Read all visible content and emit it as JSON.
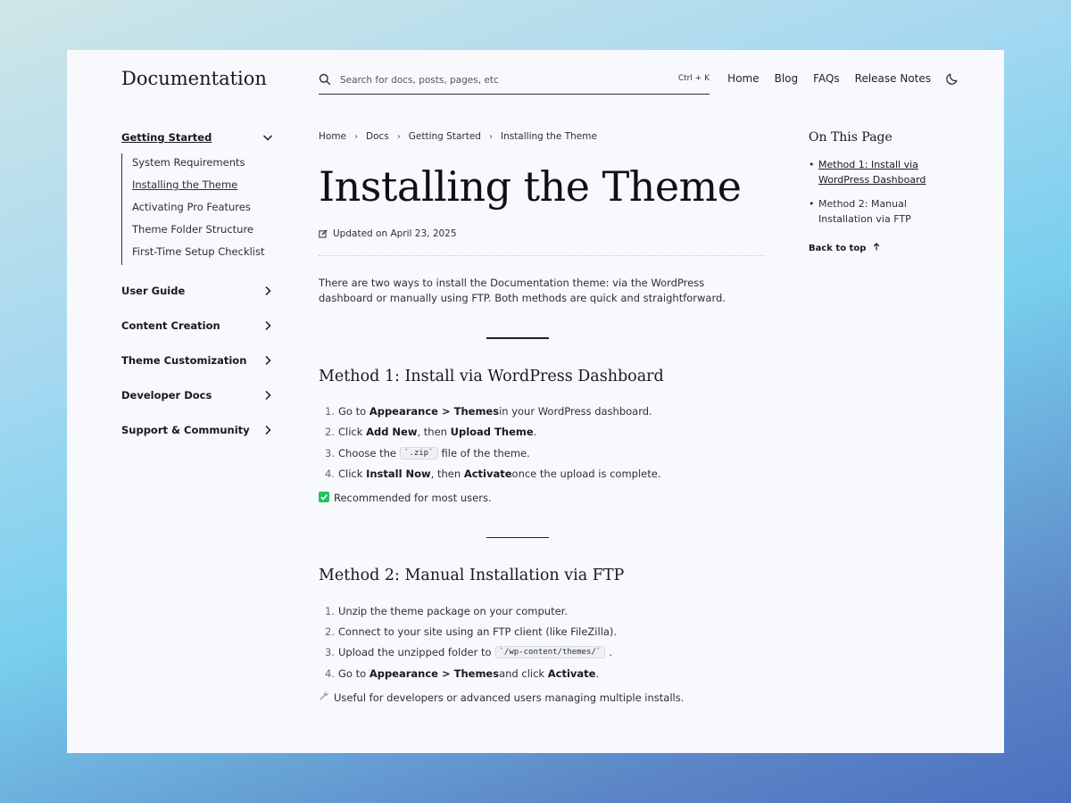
{
  "header": {
    "site_title": "Documentation",
    "search_placeholder": "Search for docs, posts, pages, etc",
    "search_shortcut": "Ctrl + K",
    "nav": [
      "Home",
      "Blog",
      "FAQs",
      "Release Notes"
    ]
  },
  "sidebar": {
    "active_section": "Getting Started",
    "active_items": [
      "System Requirements",
      "Installing the Theme",
      "Activating Pro Features",
      "Theme Folder Structure",
      "First-Time Setup Checklist"
    ],
    "sections": [
      "User Guide",
      "Content Creation",
      "Theme Customization",
      "Developer Docs",
      "Support & Community"
    ]
  },
  "breadcrumb": [
    "Home",
    "Docs",
    "Getting Started",
    "Installing the Theme"
  ],
  "page": {
    "title": "Installing the Theme",
    "updated": "Updated on April 23, 2025",
    "intro": "There are two ways to install the Documentation theme: via the WordPress dashboard or manually using FTP. Both methods are quick and straightforward.",
    "method1": {
      "heading": "Method 1: Install via WordPress Dashboard",
      "steps": [
        {
          "n": "1.",
          "a": "Go to ",
          "b": "Appearance > Themes",
          "c": " in your WordPress dashboard."
        },
        {
          "n": "2.",
          "a": "Click ",
          "b": "Add New",
          "c": ", then ",
          "d": "Upload Theme",
          "e": "."
        },
        {
          "n": "3.",
          "a": "Choose the ",
          "code": "`.zip`",
          "c": " file of the theme."
        },
        {
          "n": "4.",
          "a": "Click ",
          "b": "Install Now",
          "c": ", then ",
          "d": "Activate",
          "e": " once the upload is complete."
        }
      ],
      "note": "Recommended for most users."
    },
    "method2": {
      "heading": "Method 2: Manual Installation via FTP",
      "steps": [
        {
          "n": "1.",
          "a": "Unzip the theme package on your computer."
        },
        {
          "n": "2.",
          "a": "Connect to your site using an FTP client (like FileZilla)."
        },
        {
          "n": "3.",
          "a": "Upload the unzipped folder to ",
          "code": "`/wp-content/themes/`",
          "c": "."
        },
        {
          "n": "4.",
          "a": "Go to ",
          "b": "Appearance > Themes",
          "c": " and click ",
          "d": "Activate",
          "e": "."
        }
      ],
      "note": "Useful for developers or advanced users managing multiple installs."
    }
  },
  "toc": {
    "title": "On This Page",
    "items": [
      "Method 1: Install via WordPress Dashboard",
      "Method 2: Manual Installation via FTP"
    ],
    "back_to_top": "Back to top"
  },
  "icons": {
    "search": "search-icon",
    "theme_toggle": "moon-icon",
    "chevron_down": "chevron-down-icon",
    "chevron_right": "chevron-right-icon",
    "edit": "edit-icon",
    "check": "check-box-icon",
    "wrench": "wrench-icon",
    "arrow_up": "arrow-up-icon"
  },
  "colors": {
    "check_green": "#22c55e",
    "page_bg": "#f7f9fc"
  }
}
